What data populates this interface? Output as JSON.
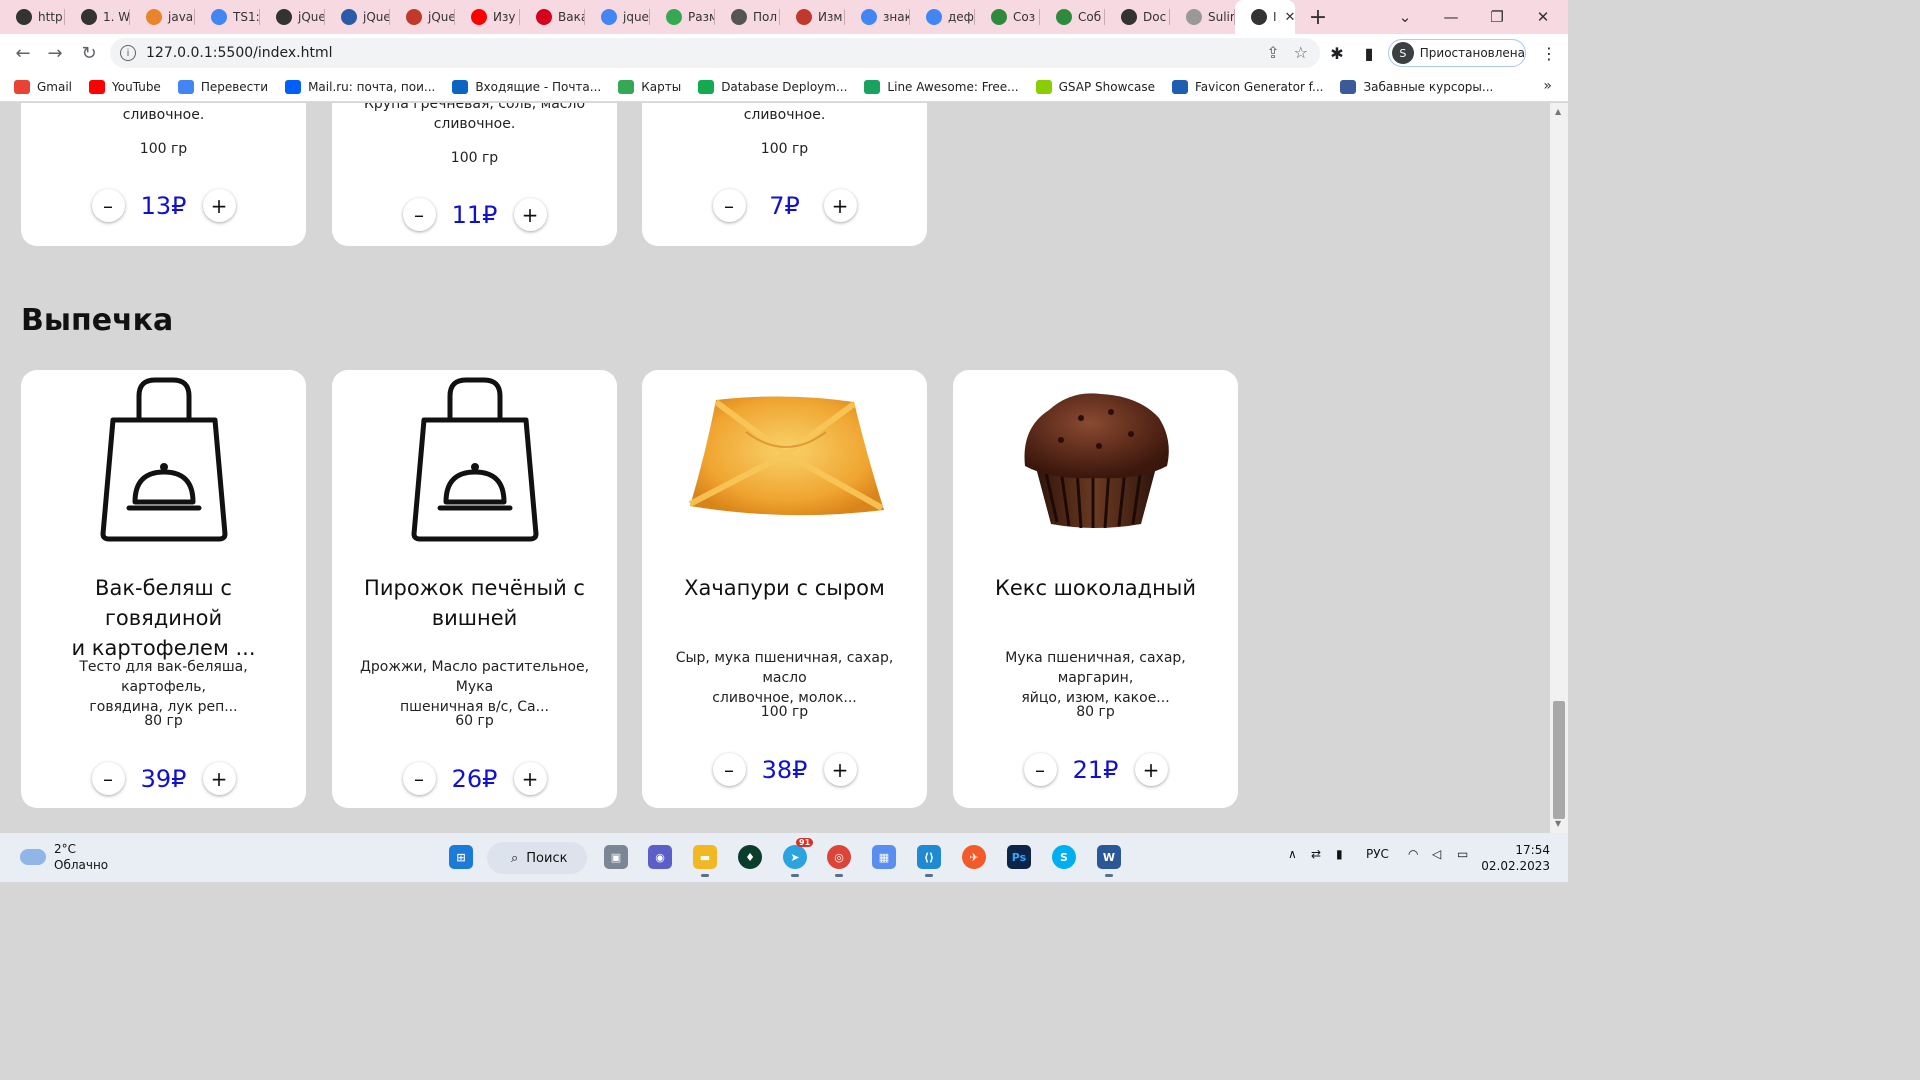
{
  "browser": {
    "tabs": [
      {
        "label": "http",
        "icon": "globe-icon",
        "color": "#333333"
      },
      {
        "label": "1. W",
        "icon": "hacker-icon",
        "color": "#333333"
      },
      {
        "label": "java",
        "icon": "java-icon",
        "color": "#e8842b"
      },
      {
        "label": "TS1:",
        "icon": "google-icon",
        "color": "#4285f4"
      },
      {
        "label": "jQue",
        "icon": "globe-icon",
        "color": "#333333"
      },
      {
        "label": "jQue",
        "icon": "site-icon",
        "color": "#2a5ba8"
      },
      {
        "label": "jQue",
        "icon": "code-icon",
        "color": "#c0392b"
      },
      {
        "label": "Изу",
        "icon": "youtube-icon",
        "color": "#ff0000"
      },
      {
        "label": "Вака",
        "icon": "hh-icon",
        "color": "#d6001c"
      },
      {
        "label": "jque",
        "icon": "google-icon",
        "color": "#4285f4"
      },
      {
        "label": "Разм",
        "icon": "code-icon",
        "color": "#34a853"
      },
      {
        "label": "Пол",
        "icon": "mail-icon",
        "color": "#555555"
      },
      {
        "label": "Изм",
        "icon": "tower-icon",
        "color": "#c0392b"
      },
      {
        "label": "знак",
        "icon": "google-icon",
        "color": "#4285f4"
      },
      {
        "label": "деф",
        "icon": "google-icon",
        "color": "#4285f4"
      },
      {
        "label": "Соз",
        "icon": "leaf-icon",
        "color": "#2e8b3d"
      },
      {
        "label": "Соб",
        "icon": "leaf-icon",
        "color": "#2e8b3d"
      },
      {
        "label": "Doc",
        "icon": "globe-icon",
        "color": "#333333"
      },
      {
        "label": "Sulir",
        "icon": "github-icon",
        "color": "#999999"
      },
      {
        "label": "I",
        "icon": "globe-icon",
        "color": "#333333",
        "active": true
      }
    ],
    "url": "127.0.0.1:5500/index.html",
    "profile_initial": "S",
    "profile_status": "Приостановлена",
    "bookmarks": [
      {
        "label": "Gmail",
        "color": "#ea4335"
      },
      {
        "label": "YouTube",
        "color": "#ff0000"
      },
      {
        "label": "Перевести",
        "color": "#4285f4"
      },
      {
        "label": "Mail.ru: почта, пои...",
        "color": "#005ff9"
      },
      {
        "label": "Входящие - Почта...",
        "color": "#0a66c2"
      },
      {
        "label": "Карты",
        "color": "#34a853"
      },
      {
        "label": "Database Deploym...",
        "color": "#13aa52"
      },
      {
        "label": "Line Awesome: Free...",
        "color": "#1aa260"
      },
      {
        "label": "GSAP Showcase",
        "color": "#88ce02"
      },
      {
        "label": "Favicon Generator f...",
        "color": "#1e5fb4"
      },
      {
        "label": "Забавные курсоры...",
        "color": "#3a5a9a"
      }
    ],
    "more_bookmarks": "»"
  },
  "top_row": [
    {
      "ingredients": [
        "сливочное."
      ],
      "weight": "100 гр",
      "price": "13₽"
    },
    {
      "ingredients": [
        "Крупа гречневая, соль, масло",
        "сливочное."
      ],
      "weight": "100 гр",
      "price": "11₽"
    },
    {
      "ingredients": [
        "сливочное."
      ],
      "weight": "100 гр",
      "price": "7₽"
    }
  ],
  "section": {
    "title": "Выпечка",
    "products": [
      {
        "title_lines": [
          "Вак-беляш с говядиной",
          "и картофелем ..."
        ],
        "ingredients": [
          "Тесто для вак-беляша, картофель,",
          "говядина, лук реп..."
        ],
        "weight": "80 гр",
        "price": "39₽",
        "image": "bag-placeholder-icon"
      },
      {
        "title_lines": [
          "Пирожок печёный с",
          "вишней"
        ],
        "ingredients": [
          "Дрожжи, Масло растительное, Мука",
          "пшеничная в/с, Са..."
        ],
        "weight": "60 гр",
        "price": "26₽",
        "image": "bag-placeholder-icon"
      },
      {
        "title_lines": [
          "Хачапури с сыром"
        ],
        "ingredients": [
          "Сыр, мука пшеничная, сахар, масло",
          "сливочное, молок..."
        ],
        "weight": "100 гр",
        "price": "38₽",
        "image": "khachapuri-photo"
      },
      {
        "title_lines": [
          "Кекс шоколадный"
        ],
        "ingredients": [
          "Мука пшеничная, сахар, маргарин,",
          "яйцо, изюм, какое..."
        ],
        "weight": "80 гр",
        "price": "21₽",
        "image": "muffin-photo"
      }
    ]
  },
  "controls": {
    "minus": "–",
    "plus": "+"
  },
  "taskbar": {
    "temperature": "2°C",
    "weather": "Облачно",
    "search_label": "Поиск",
    "language": "РУС",
    "time": "17:54",
    "date": "02.02.2023",
    "telegram_badge": "91"
  },
  "colors": {
    "price": "#1010d0",
    "page_bg": "#d6d6d6",
    "card_bg": "#ffffff"
  }
}
